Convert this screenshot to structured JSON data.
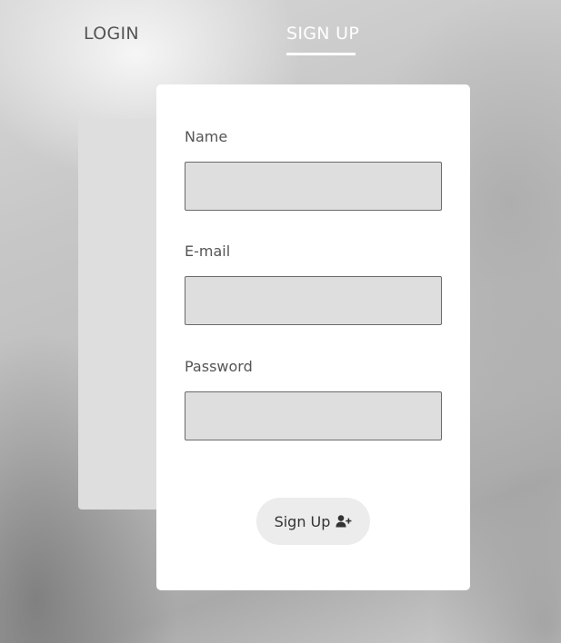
{
  "tabs": {
    "login": "LOGIN",
    "signup": "SIGN UP",
    "active": "signup"
  },
  "form": {
    "name_label": "Name",
    "name_value": "",
    "email_label": "E-mail",
    "email_value": "",
    "password_label": "Password",
    "password_value": "",
    "submit_label": "Sign Up",
    "submit_icon": "user-plus-icon"
  },
  "colors": {
    "card": "#ffffff",
    "input_bg": "#dedede",
    "button_bg": "#ececec",
    "active_tab": "#ffffff"
  }
}
